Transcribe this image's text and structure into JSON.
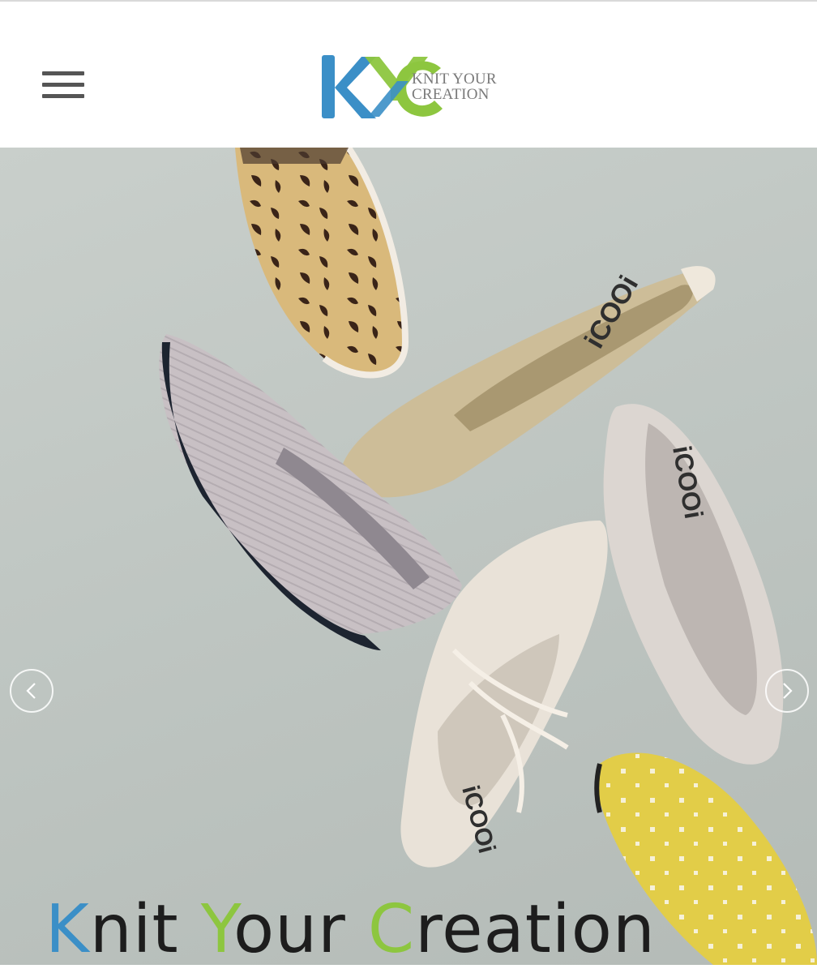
{
  "header": {
    "menu_icon": "hamburger-menu-icon",
    "logo": {
      "line1": "KNIT YOUR",
      "line2": "CREATION",
      "colors": {
        "blue": "#3b8fc7",
        "green": "#8dc63f",
        "text": "#7a7a7a"
      }
    }
  },
  "hero": {
    "prev_icon": "chevron-left-icon",
    "next_icon": "chevron-right-icon",
    "tagline": {
      "w1_initial": "K",
      "w1_rest": "nit",
      "w2_initial": "Y",
      "w2_rest": "our",
      "w3_initial": "C",
      "w3_rest": "reation"
    },
    "shoe_brand_marks": [
      "iCOOi",
      "iCOOi",
      "iCOOi"
    ]
  }
}
